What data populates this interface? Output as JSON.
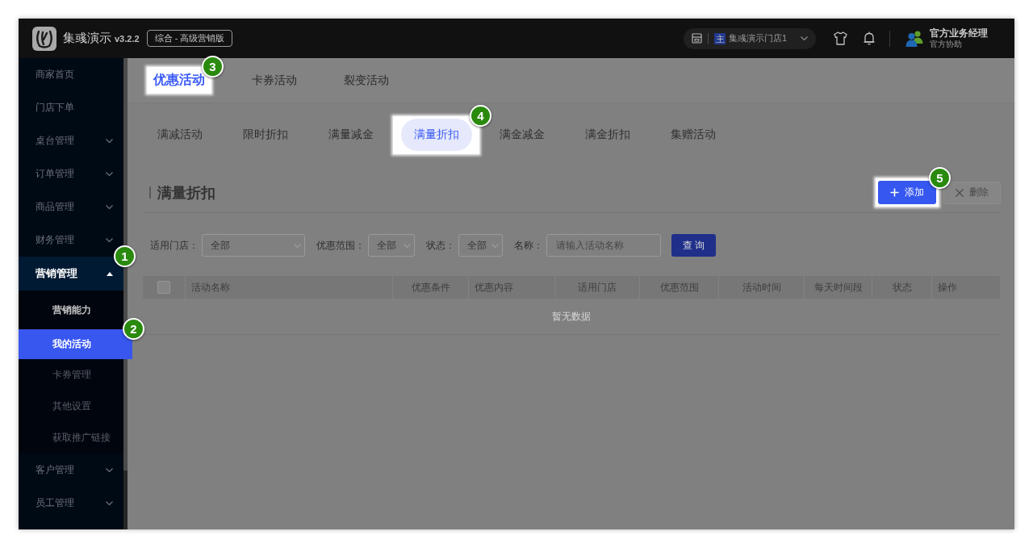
{
  "top_bar": {
    "brand": "集彧演示",
    "version": "v3.2.2",
    "edition": "综合 - 高级营销版",
    "store": {
      "tag": "主",
      "name": "集彧演示门店1"
    },
    "user": {
      "name": "官方业务经理",
      "role": "官方协助"
    }
  },
  "sidebar": {
    "items": [
      {
        "label": "商家首页",
        "kind": "link"
      },
      {
        "label": "门店下单",
        "kind": "link"
      },
      {
        "label": "桌台管理",
        "kind": "group",
        "expanded": false
      },
      {
        "label": "订单管理",
        "kind": "group",
        "expanded": false
      },
      {
        "label": "商品管理",
        "kind": "group",
        "expanded": false
      },
      {
        "label": "财务管理",
        "kind": "group",
        "expanded": false
      },
      {
        "label": "营销管理",
        "kind": "group",
        "expanded": true,
        "step": "1",
        "children": [
          {
            "label": "营销能力",
            "selected": false,
            "spotlight": true
          },
          {
            "label": "我的活动",
            "selected": true,
            "spotlight": true,
            "step": "2"
          },
          {
            "label": "卡券管理",
            "selected": false,
            "spotlight": false
          },
          {
            "label": "其他设置",
            "selected": false,
            "spotlight": false
          },
          {
            "label": "获取推广链接",
            "selected": false,
            "spotlight": false
          }
        ]
      },
      {
        "label": "客户管理",
        "kind": "group",
        "expanded": false
      },
      {
        "label": "员工管理",
        "kind": "group",
        "expanded": false
      }
    ]
  },
  "activity_tabs": [
    {
      "label": "优惠活动",
      "selected": true,
      "spotlight": true,
      "step": "3"
    },
    {
      "label": "卡券活动",
      "selected": false,
      "spotlight": false
    },
    {
      "label": "裂变活动",
      "selected": false,
      "spotlight": false
    }
  ],
  "promo_tabs": [
    {
      "label": "满减活动",
      "selected": false,
      "spotlight": false
    },
    {
      "label": "限时折扣",
      "selected": false,
      "spotlight": false
    },
    {
      "label": "满量减金",
      "selected": false,
      "spotlight": false
    },
    {
      "label": "满量折扣",
      "selected": true,
      "spotlight": true,
      "step": "4"
    },
    {
      "label": "满金减金",
      "selected": false,
      "spotlight": false
    },
    {
      "label": "满金折扣",
      "selected": false,
      "spotlight": false
    },
    {
      "label": "集赠活动",
      "selected": false,
      "spotlight": false
    }
  ],
  "section": {
    "title": "满量折扣",
    "actions": [
      {
        "label": "添加",
        "kind": "add",
        "disabled": false,
        "spotlight": true,
        "step": "5"
      },
      {
        "label": "删除",
        "kind": "delete",
        "disabled": true,
        "spotlight": false
      }
    ]
  },
  "filters": {
    "fields": [
      {
        "label": "适用门店：",
        "kind": "select",
        "value": "全部"
      },
      {
        "label": "优惠范围：",
        "kind": "select",
        "value": "全部"
      },
      {
        "label": "状态：",
        "kind": "select",
        "value": "全部"
      },
      {
        "label": "名称：",
        "kind": "text",
        "placeholder": "请输入活动名称"
      }
    ],
    "query_button": "查 询"
  },
  "table": {
    "select_all": {
      "checked": false
    },
    "columns": [
      "活动名称",
      "优惠条件",
      "优惠内容",
      "适用门店",
      "优惠范围",
      "活动时间",
      "每天时间段",
      "状态",
      "操作"
    ],
    "empty_text": "暂无数据"
  }
}
